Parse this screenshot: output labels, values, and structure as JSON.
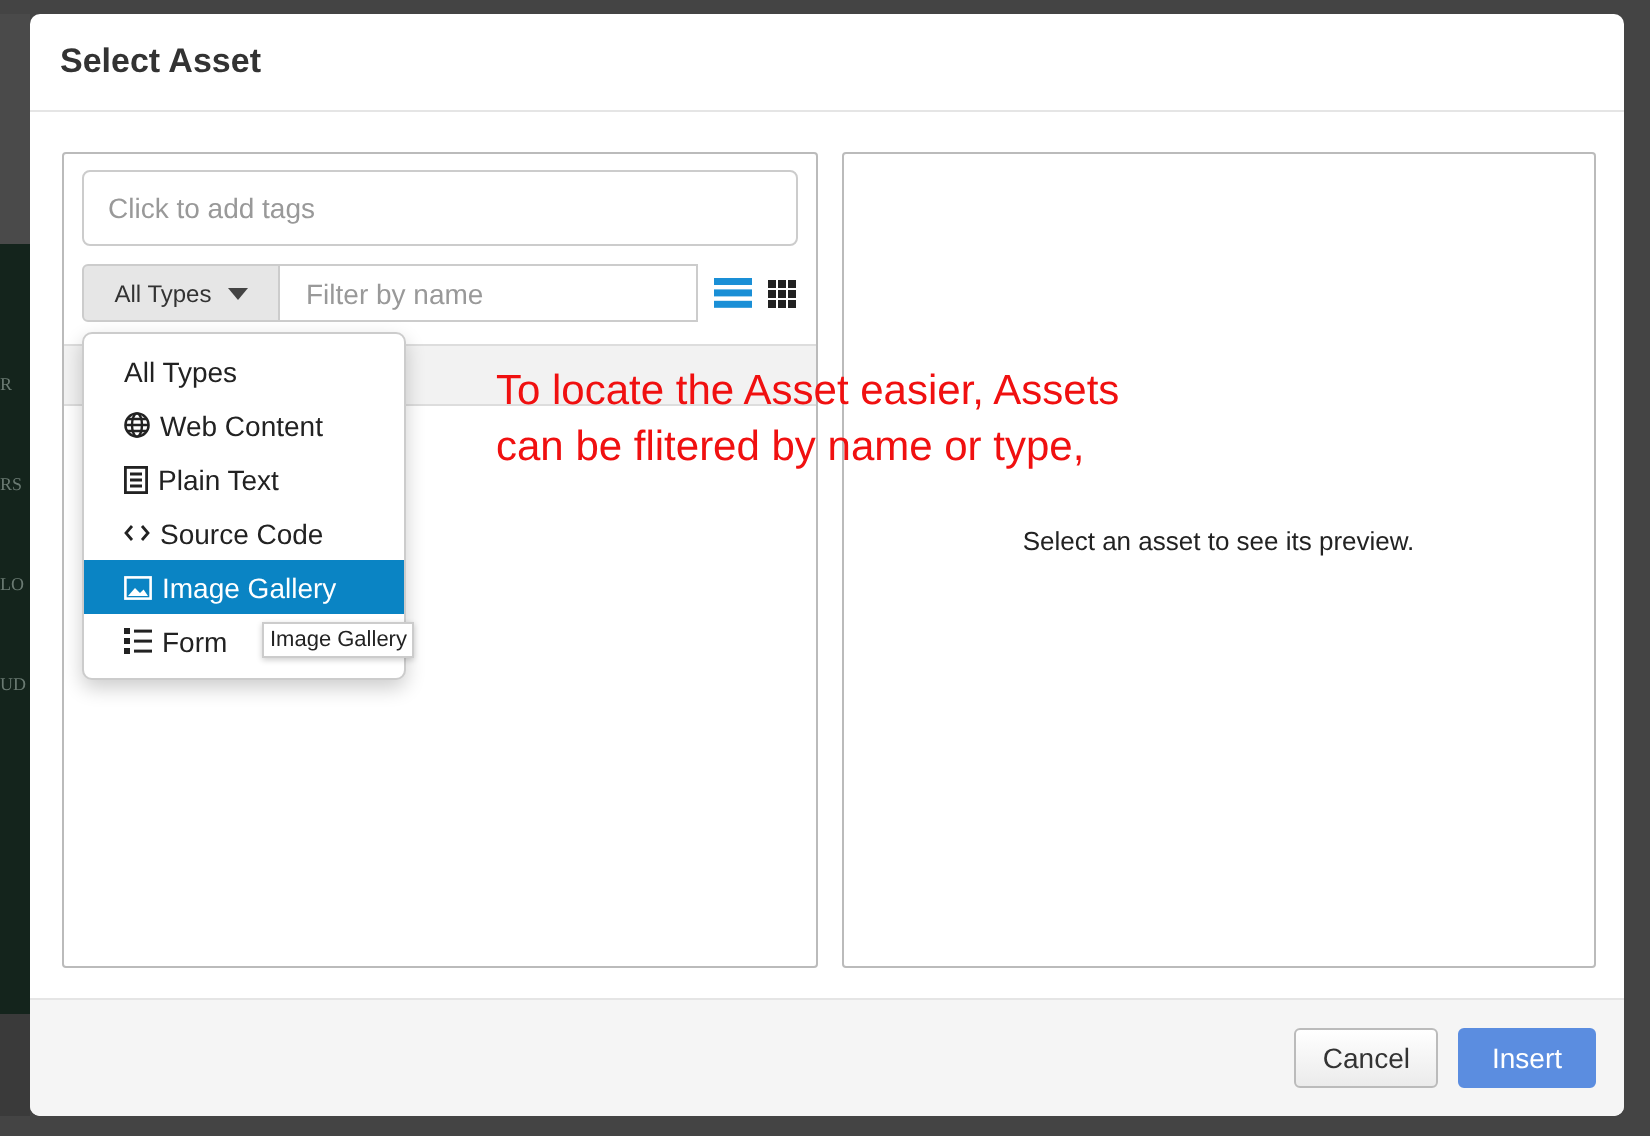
{
  "background": {
    "fragments": [
      "R",
      "RS",
      "LO",
      "UD"
    ]
  },
  "dialog": {
    "title": "Select Asset",
    "tags_field": {
      "placeholder": "Click to add tags"
    },
    "type_dropdown": {
      "label": "All Types",
      "expanded": true,
      "options": [
        {
          "label": "All Types",
          "kind": "all",
          "selected": false
        },
        {
          "label": "Web Content",
          "kind": "web",
          "selected": false
        },
        {
          "label": "Plain Text",
          "kind": "text",
          "selected": false
        },
        {
          "label": "Source Code",
          "kind": "code",
          "selected": false
        },
        {
          "label": "Image Gallery",
          "kind": "gallery",
          "selected": true
        },
        {
          "label": "Form",
          "kind": "form",
          "selected": false
        }
      ]
    },
    "tooltip": "Image Gallery",
    "filter_field": {
      "placeholder": "Filter by name"
    },
    "view_buttons": [
      {
        "kind": "list",
        "selected": true
      },
      {
        "kind": "grid",
        "selected": false
      }
    ],
    "annotation": "To locate the Asset easier, Assets can be flitered by name or type,",
    "preview_message": "Select an asset to see its preview.",
    "buttons": [
      {
        "label": "Cancel",
        "kind": "secondary"
      },
      {
        "label": "Insert",
        "kind": "primary"
      }
    ]
  }
}
